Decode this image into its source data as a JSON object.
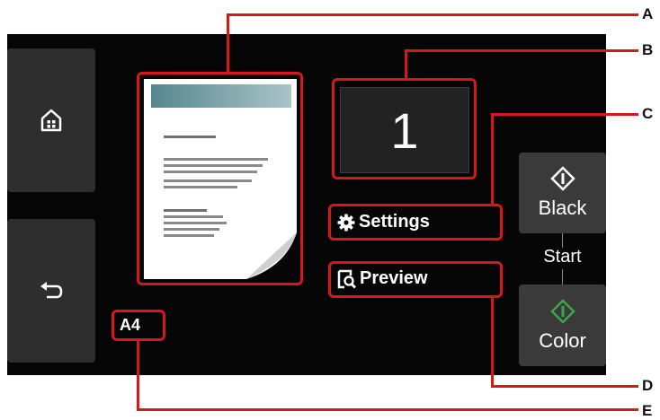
{
  "side_buttons": [
    {
      "icon": "home-icon"
    },
    {
      "icon": "back-arrow-icon"
    }
  ],
  "copies": "1",
  "settings_label": "Settings",
  "preview_label": "Preview",
  "start": {
    "black_label": "Black",
    "start_label": "Start",
    "color_label": "Color"
  },
  "paper_size": "A4",
  "callout_labels": {
    "a": "A",
    "b": "B",
    "c": "C",
    "d": "D",
    "e": "E"
  },
  "colors": {
    "callout": "#d6171c",
    "color_diamond": "#3aa846",
    "screen_bg": "#060606"
  }
}
